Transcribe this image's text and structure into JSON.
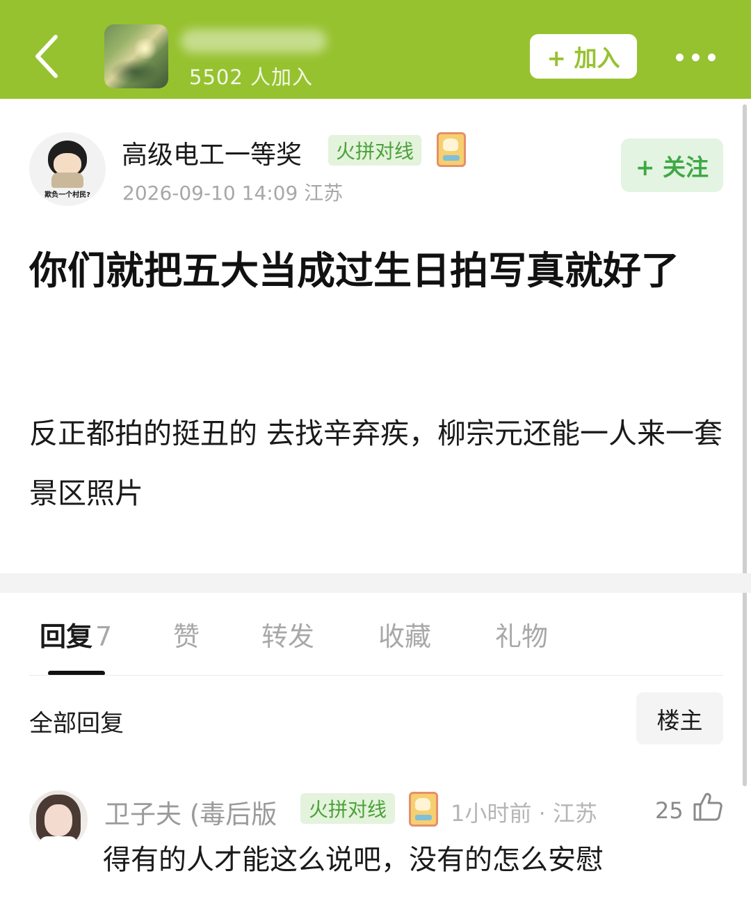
{
  "header": {
    "group_member_count": "5502 人加入",
    "join_label": "+ 加入",
    "background_color": "#97c230"
  },
  "post": {
    "author": {
      "name": "高级电工一等奖",
      "tag": "火拼对线",
      "avatar_caption": "欺负一个村民?"
    },
    "meta": "2026-09-10 14:09  江苏",
    "follow_label": "+ 关注",
    "title": "你们就把五大当成过生日拍写真就好了",
    "body": "反正都拍的挺丑的 去找辛弃疾，柳宗元还能一人来一套景区照片"
  },
  "tabs": {
    "reply": "回复",
    "reply_count": "7",
    "like": "赞",
    "forward": "转发",
    "collect": "收藏",
    "gift": "礼物"
  },
  "replies": {
    "header": "全部回复",
    "owner_filter": "楼主",
    "items": [
      {
        "name": "卫子夫 (毒后版",
        "tag": "火拼对线",
        "time": "1小时前 · 江苏",
        "likes": "25",
        "text": "得有的人才能这么说吧，没有的怎么安慰"
      }
    ]
  },
  "colors": {
    "accent_green": "#97c230",
    "tag_text": "#4ba23a",
    "tag_bg": "#e4f3dc",
    "follow_text": "#3fa845"
  },
  "icons": {
    "back": "chevron-left-icon",
    "more": "more-dots-icon",
    "badge": "cat-badge-icon",
    "like": "thumbs-up-icon"
  }
}
